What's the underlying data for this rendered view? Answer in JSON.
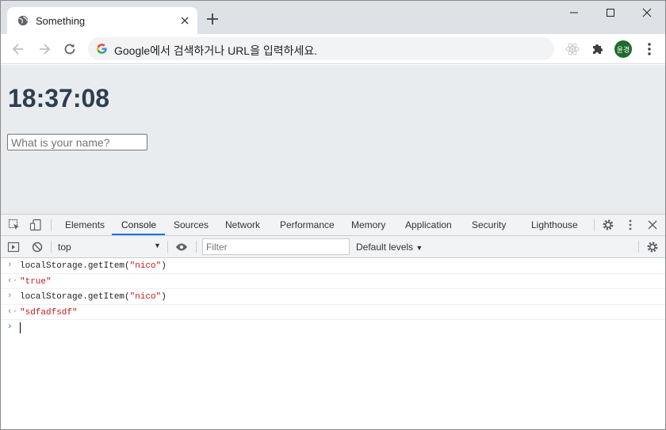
{
  "browser": {
    "tab_title": "Something",
    "omnibox_text": "Google에서 검색하거나 URL을 입력하세요.",
    "avatar_text": "윤경"
  },
  "page": {
    "clock": "18:37:08",
    "name_placeholder": "What is your name?"
  },
  "devtools": {
    "tabs": [
      "Elements",
      "Console",
      "Sources",
      "Network",
      "Performance",
      "Memory",
      "Application",
      "Security",
      "Lighthouse"
    ],
    "active_tab": "Console",
    "context": "top",
    "filter_placeholder": "Filter",
    "levels": "Default levels",
    "console": [
      {
        "kind": "input",
        "code": "localStorage.getItem(",
        "arg": "\"nico\"",
        "close": ")"
      },
      {
        "kind": "result",
        "value": "\"true\""
      },
      {
        "kind": "input",
        "code": "localStorage.getItem(",
        "arg": "\"nico\"",
        "close": ")"
      },
      {
        "kind": "result",
        "value": "\"sdfadfsdf\""
      }
    ]
  },
  "colors": {
    "titlebar": "#dee1e6",
    "page_bg": "#e9ecef",
    "clock": "#2c3e50",
    "accent": "#1a73e8",
    "string": "#c41a16"
  }
}
